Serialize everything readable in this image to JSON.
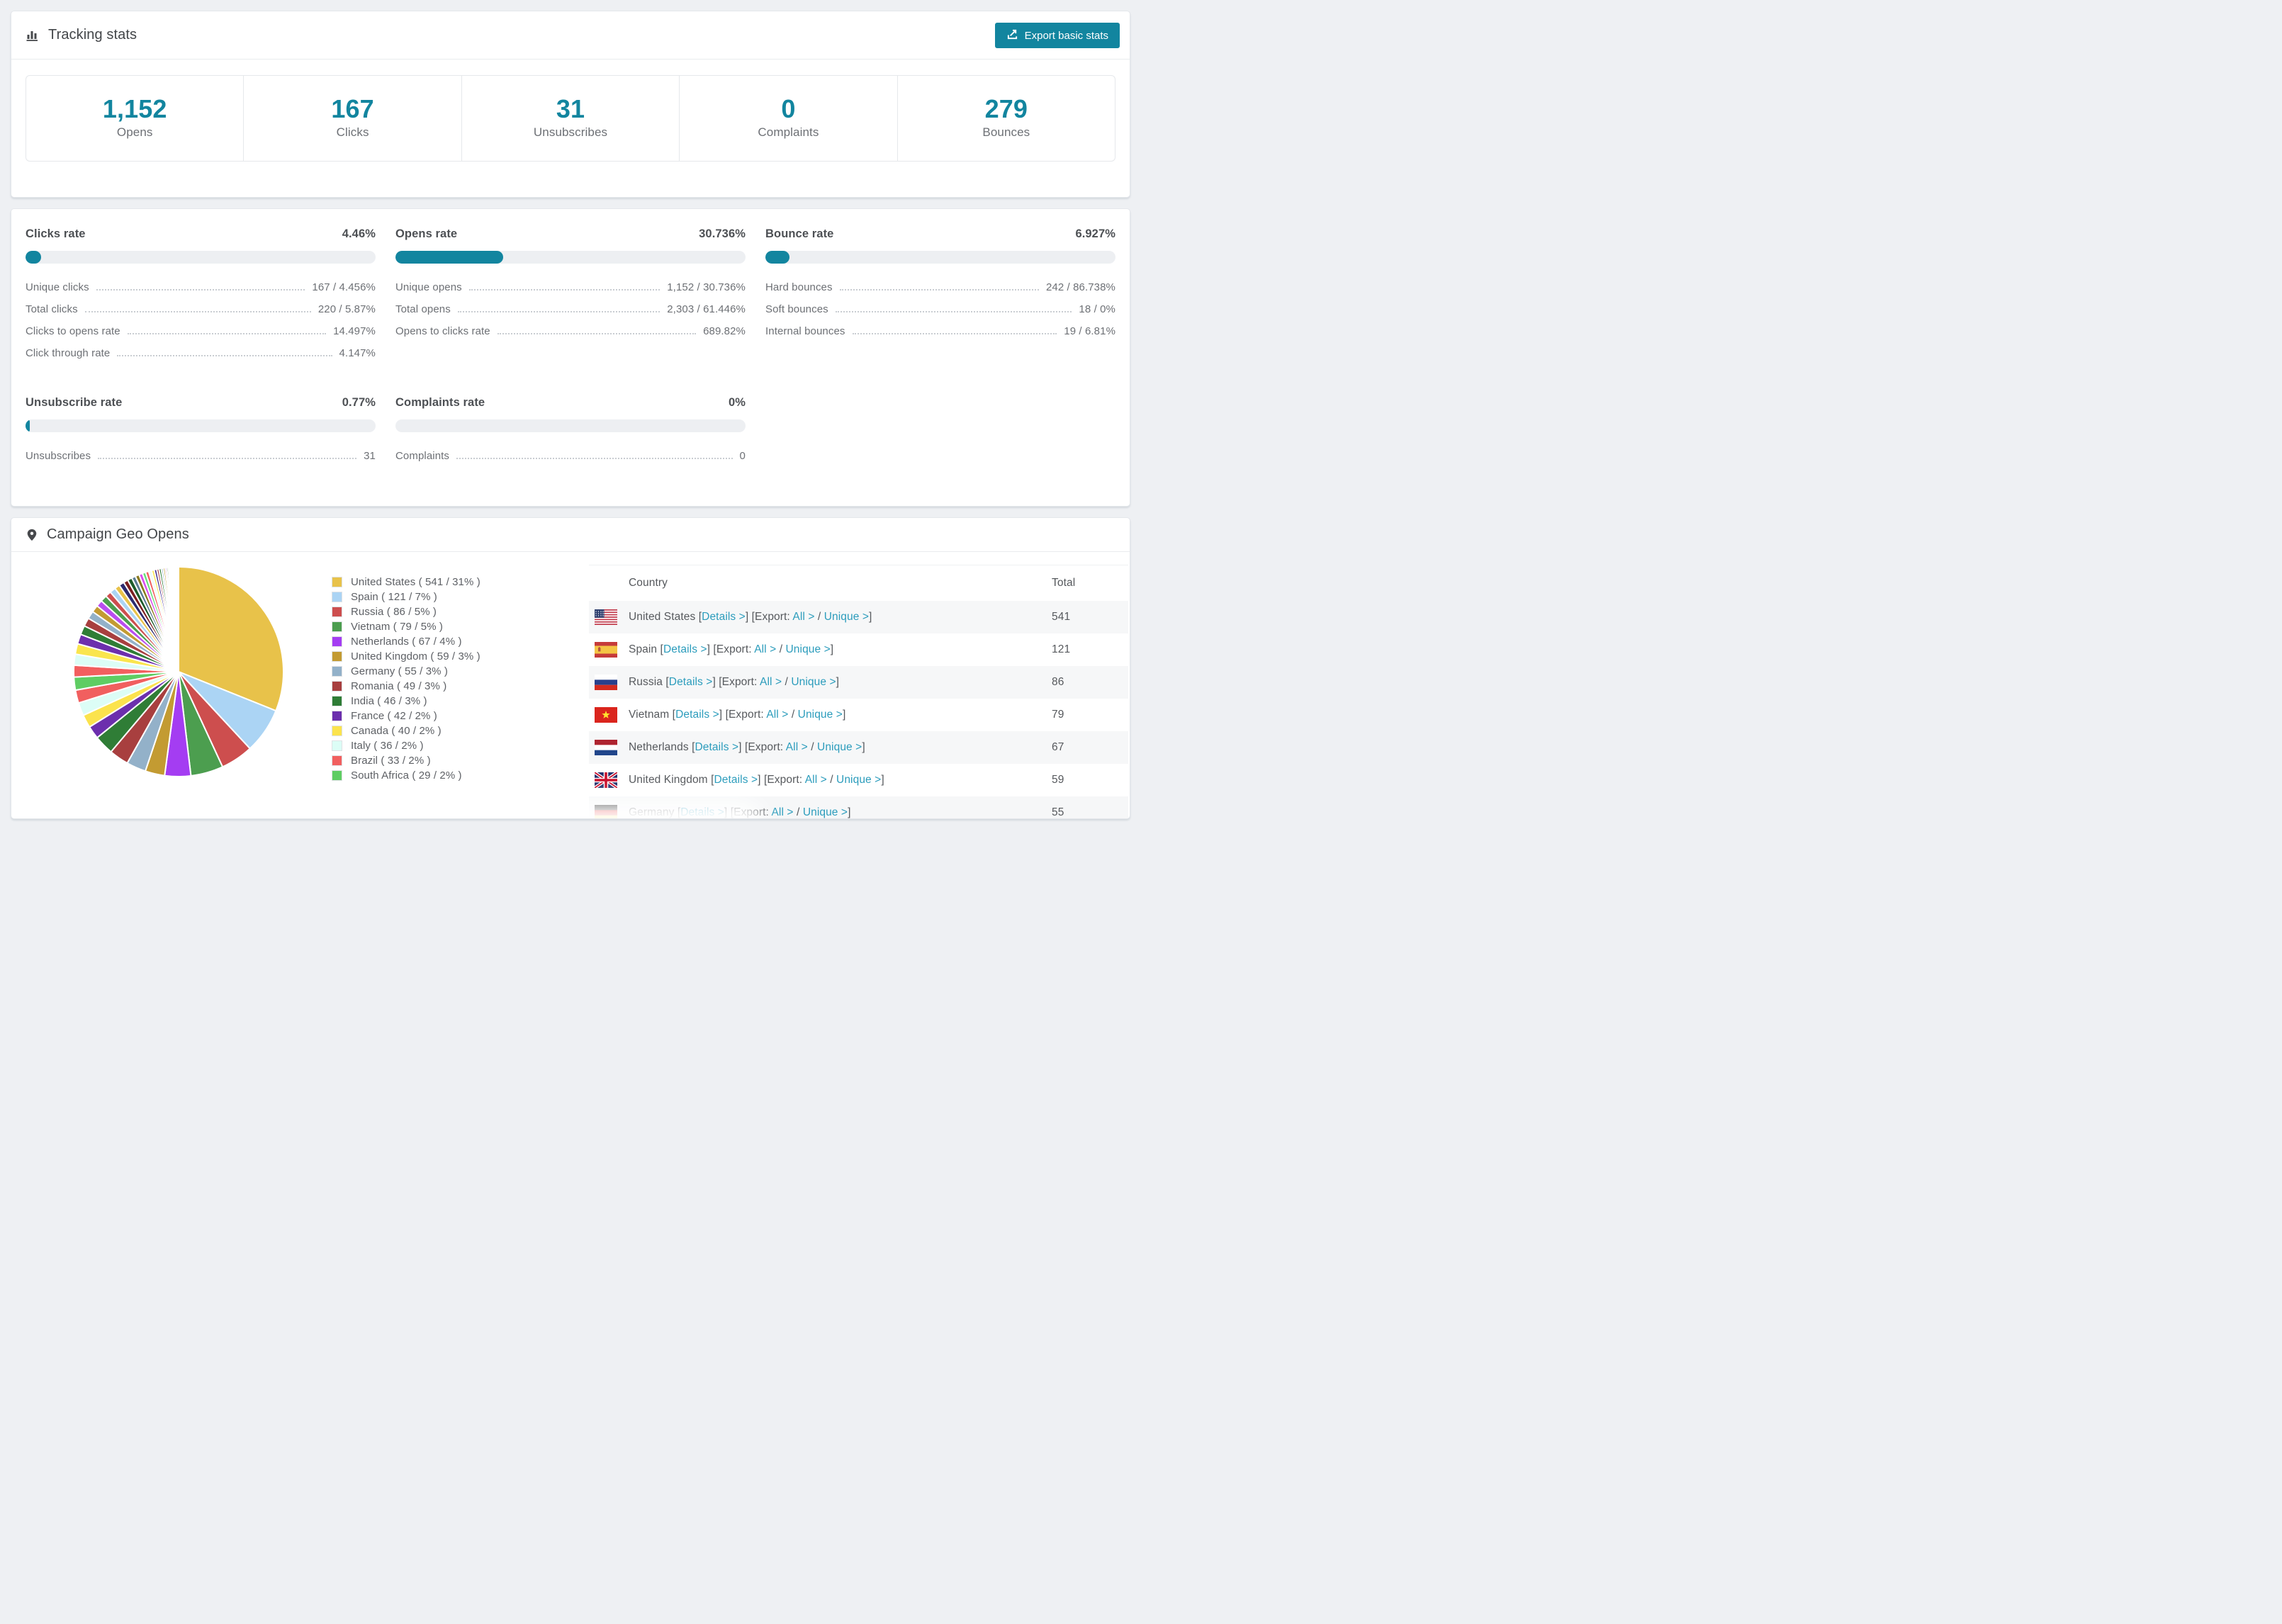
{
  "colors": {
    "accent": "#12859f",
    "link": "#2b9cbc",
    "bar_track": "#edeff2",
    "page_bg": "#eef0f3"
  },
  "icons": {
    "header": "bar-chart-icon",
    "export": "export-icon",
    "geo": "map-pin-icon"
  },
  "header": {
    "title": "Tracking stats",
    "export_label": "Export basic stats"
  },
  "summary": [
    {
      "value": "1,152",
      "label": "Opens"
    },
    {
      "value": "167",
      "label": "Clicks"
    },
    {
      "value": "31",
      "label": "Unsubscribes"
    },
    {
      "value": "0",
      "label": "Complaints"
    },
    {
      "value": "279",
      "label": "Bounces"
    }
  ],
  "rates": [
    {
      "title": "Clicks rate",
      "value": "4.46%",
      "percent": 4.46,
      "rows": [
        {
          "label": "Unique clicks",
          "value": "167 / 4.456%"
        },
        {
          "label": "Total clicks",
          "value": "220 / 5.87%"
        },
        {
          "label": "Clicks to opens rate",
          "value": "14.497%"
        },
        {
          "label": "Click through rate",
          "value": "4.147%"
        }
      ]
    },
    {
      "title": "Opens rate",
      "value": "30.736%",
      "percent": 30.736,
      "rows": [
        {
          "label": "Unique opens",
          "value": "1,152 / 30.736%"
        },
        {
          "label": "Total opens",
          "value": "2,303 / 61.446%"
        },
        {
          "label": "Opens to clicks rate",
          "value": "689.82%"
        }
      ]
    },
    {
      "title": "Bounce rate",
      "value": "6.927%",
      "percent": 6.927,
      "rows": [
        {
          "label": "Hard bounces",
          "value": "242 / 86.738%"
        },
        {
          "label": "Soft bounces",
          "value": "18 / 0%"
        },
        {
          "label": "Internal bounces",
          "value": "19 / 6.81%"
        }
      ]
    },
    {
      "title": "Unsubscribe rate",
      "value": "0.77%",
      "percent": 0.77,
      "rows": [
        {
          "label": "Unsubscribes",
          "value": "31"
        }
      ]
    },
    {
      "title": "Complaints rate",
      "value": "0%",
      "percent": 0,
      "rows": [
        {
          "label": "Complaints",
          "value": "0"
        }
      ]
    }
  ],
  "geo": {
    "title": "Campaign Geo Opens",
    "table": {
      "col_country": "Country",
      "col_total": "Total",
      "link_details": "Details",
      "export_prefix": "Export:",
      "link_all": "All",
      "link_unique": "Unique",
      "rows": [
        {
          "flag": "us",
          "country": "United States",
          "total": "541"
        },
        {
          "flag": "es",
          "country": "Spain",
          "total": "121"
        },
        {
          "flag": "ru",
          "country": "Russia",
          "total": "86"
        },
        {
          "flag": "vn",
          "country": "Vietnam",
          "total": "79"
        },
        {
          "flag": "nl",
          "country": "Netherlands",
          "total": "67"
        },
        {
          "flag": "gb",
          "country": "United Kingdom",
          "total": "59"
        },
        {
          "flag": "de",
          "country": "Germany",
          "total": "55"
        }
      ]
    },
    "chart_data": {
      "type": "pie",
      "title": "Campaign Geo Opens",
      "legend_position": "right",
      "series": [
        {
          "name": "United States",
          "value": 541,
          "pct": 31,
          "color": "#e8c24a"
        },
        {
          "name": "Spain",
          "value": 121,
          "pct": 7,
          "color": "#abd4f4"
        },
        {
          "name": "Russia",
          "value": 86,
          "pct": 5,
          "color": "#cd4e4e"
        },
        {
          "name": "Vietnam",
          "value": 79,
          "pct": 5,
          "color": "#4c9e4f"
        },
        {
          "name": "Netherlands",
          "value": 67,
          "pct": 4,
          "color": "#a43df2"
        },
        {
          "name": "United Kingdom",
          "value": 59,
          "pct": 3,
          "color": "#c39b32"
        },
        {
          "name": "Germany",
          "value": 55,
          "pct": 3,
          "color": "#93b1c9"
        },
        {
          "name": "Romania",
          "value": 49,
          "pct": 3,
          "color": "#a83f3f"
        },
        {
          "name": "India",
          "value": 46,
          "pct": 3,
          "color": "#2f7d36"
        },
        {
          "name": "France",
          "value": 42,
          "pct": 2,
          "color": "#6c2fad"
        },
        {
          "name": "Canada",
          "value": 40,
          "pct": 2,
          "color": "#fbe34d"
        },
        {
          "name": "Italy",
          "value": 36,
          "pct": 2,
          "color": "#dcfdf6"
        },
        {
          "name": "Brazil",
          "value": 33,
          "pct": 2,
          "color": "#f15f5f"
        },
        {
          "name": "South Africa",
          "value": 29,
          "pct": 2,
          "color": "#5fcd63"
        }
      ],
      "others": [
        {
          "pct": 1.8,
          "color": "#f25f5f"
        },
        {
          "pct": 1.7,
          "color": "#dcfdf6"
        },
        {
          "pct": 1.6,
          "color": "#fae54d"
        },
        {
          "pct": 1.5,
          "color": "#6d2fad"
        },
        {
          "pct": 1.4,
          "color": "#2f7d36"
        },
        {
          "pct": 1.3,
          "color": "#a83f3f"
        },
        {
          "pct": 1.2,
          "color": "#93b1c9"
        },
        {
          "pct": 1.1,
          "color": "#c39b32"
        },
        {
          "pct": 1.0,
          "color": "#b94df0"
        },
        {
          "pct": 1.0,
          "color": "#4c9e4f"
        },
        {
          "pct": 0.9,
          "color": "#cd4e4e"
        },
        {
          "pct": 0.9,
          "color": "#abd4f4"
        },
        {
          "pct": 0.8,
          "color": "#e8c24a"
        },
        {
          "pct": 0.8,
          "color": "#2b2a6e"
        },
        {
          "pct": 0.7,
          "color": "#7a1f1f"
        },
        {
          "pct": 0.7,
          "color": "#1d5c2a"
        },
        {
          "pct": 0.6,
          "color": "#5b7d94"
        },
        {
          "pct": 0.6,
          "color": "#8a7a1e"
        },
        {
          "pct": 0.55,
          "color": "#d94df0"
        },
        {
          "pct": 0.5,
          "color": "#66e07a"
        },
        {
          "pct": 0.5,
          "color": "#f25f5f"
        },
        {
          "pct": 0.45,
          "color": "#eafefa"
        },
        {
          "pct": 0.4,
          "color": "#fae54d"
        },
        {
          "pct": 0.4,
          "color": "#3d2a8e"
        },
        {
          "pct": 0.35,
          "color": "#a83f3f"
        },
        {
          "pct": 0.35,
          "color": "#2f7d36"
        },
        {
          "pct": 0.3,
          "color": "#93b1c9"
        },
        {
          "pct": 0.3,
          "color": "#c39b32"
        },
        {
          "pct": 0.25,
          "color": "#b94df0"
        },
        {
          "pct": 0.25,
          "color": "#4c9e4f"
        },
        {
          "pct": 0.2,
          "color": "#cd4e4e"
        },
        {
          "pct": 0.2,
          "color": "#abd4f4"
        },
        {
          "pct": 0.18,
          "color": "#e8c24a"
        },
        {
          "pct": 0.16,
          "color": "#6d2fad"
        },
        {
          "pct": 0.15,
          "color": "#f25f5f"
        },
        {
          "pct": 0.14,
          "color": "#dcfdf6"
        },
        {
          "pct": 0.12,
          "color": "#fae54d"
        },
        {
          "pct": 0.1,
          "color": "#2f7d36"
        },
        {
          "pct": 0.1,
          "color": "#a83f3f"
        },
        {
          "pct": 0.08,
          "color": "#93b1c9"
        },
        {
          "pct": 0.07,
          "color": "#66e07a"
        },
        {
          "pct": 0.05,
          "color": "#b94df0"
        }
      ]
    }
  }
}
